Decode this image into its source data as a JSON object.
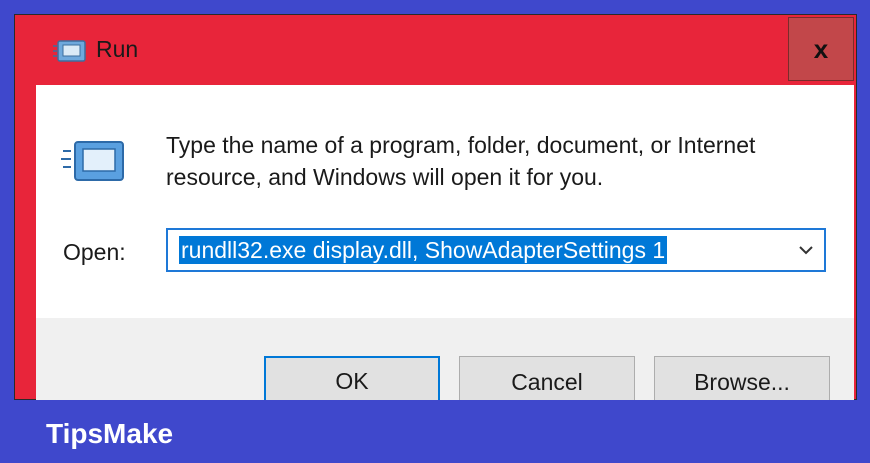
{
  "window": {
    "title": "Run",
    "close_label": "x",
    "description": "Type the name of a program, folder, document, or Internet resource, and Windows will open it for you.",
    "open_label": "Open:",
    "open_value": "rundll32.exe display.dll, ShowAdapterSettings 1",
    "buttons": {
      "ok": "OK",
      "cancel": "Cancel",
      "browse": "Browse..."
    }
  },
  "icons": [
    "run-icon",
    "close-icon",
    "chevron-down-icon"
  ],
  "brand": {
    "name": "TipsMake"
  },
  "colors": {
    "title_bar": "#e8253a",
    "background": "#3f48cc",
    "selection": "#0078d7"
  }
}
